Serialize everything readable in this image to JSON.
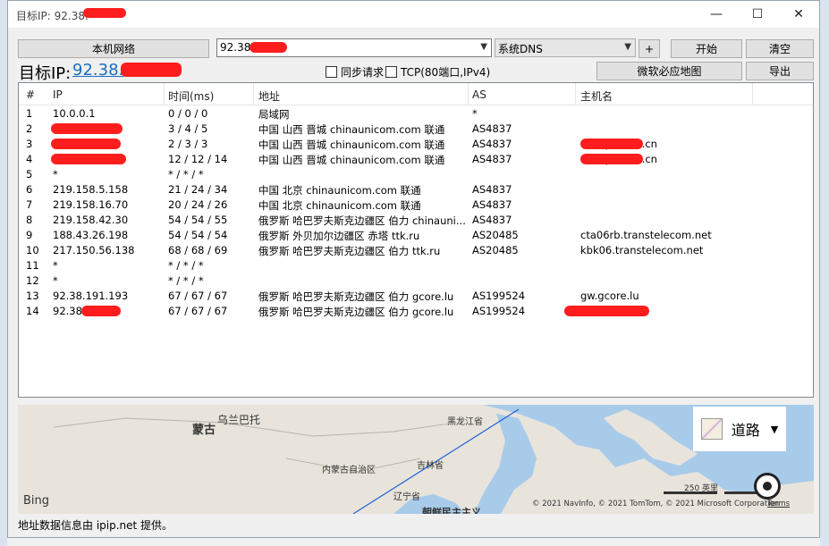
{
  "window": {
    "title": "目标IP: 92.38.",
    "minimize_glyph": "—",
    "maximize_glyph": "☐",
    "close_glyph": "✕"
  },
  "toolbar": {
    "local_network_btn": "本机网络",
    "ip_input_value": "92.38.",
    "dns_select_value": "系统DNS",
    "plus_btn": "+",
    "start_btn": "开始",
    "clear_btn": "清空",
    "map_btn": "微软必应地图",
    "export_btn": "导出"
  },
  "target": {
    "label": "目标IP:",
    "ip": "92.38."
  },
  "options": {
    "sync_label": "同步请求",
    "tcp_label": "TCP(80端口,IPv4)"
  },
  "table": {
    "headers": [
      "#",
      "IP",
      "时间(ms)",
      "地址",
      "AS",
      "主机名"
    ],
    "rows": [
      {
        "n": "1",
        "ip": "10.0.0.1",
        "time": "0 / 0 / 0",
        "addr": "局域网",
        "as": "*",
        "host": ""
      },
      {
        "n": "2",
        "ip": "",
        "time": "3 / 4 / 5",
        "addr": "中国 山西 晋城 chinaunicom.com 联通",
        "as": "AS4837",
        "host": ""
      },
      {
        "n": "3",
        "ip": "",
        "time": "2 / 3 / 3",
        "addr": "中国 山西 晋城 chinaunicom.com 联通",
        "as": "AS4837",
        "host": "adsl-pool.sx.cn"
      },
      {
        "n": "4",
        "ip": "",
        "time": "12 / 12 / 14",
        "addr": "中国 山西 晋城 chinaunicom.com 联通",
        "as": "AS4837",
        "host": "adsl-pool.sx.cn"
      },
      {
        "n": "5",
        "ip": "*",
        "time": "* / * / *",
        "addr": "",
        "as": "",
        "host": ""
      },
      {
        "n": "6",
        "ip": "219.158.5.158",
        "time": "21 / 24 / 34",
        "addr": "中国 北京 chinaunicom.com 联通",
        "as": "AS4837",
        "host": ""
      },
      {
        "n": "7",
        "ip": "219.158.16.70",
        "time": "20 / 24 / 26",
        "addr": "中国 北京 chinaunicom.com 联通",
        "as": "AS4837",
        "host": ""
      },
      {
        "n": "8",
        "ip": "219.158.42.30",
        "time": "54 / 54 / 55",
        "addr": "俄罗斯 哈巴罗夫斯克边疆区 伯力 chinauni...",
        "as": "AS4837",
        "host": ""
      },
      {
        "n": "9",
        "ip": "188.43.26.198",
        "time": "54 / 54 / 54",
        "addr": "俄罗斯 外贝加尔边疆区 赤塔 ttk.ru",
        "as": "AS20485",
        "host": "cta06rb.transtelecom.net"
      },
      {
        "n": "10",
        "ip": "217.150.56.138",
        "time": "68 / 68 / 69",
        "addr": "俄罗斯 哈巴罗夫斯克边疆区 伯力 ttk.ru",
        "as": "AS20485",
        "host": "kbk06.transtelecom.net"
      },
      {
        "n": "11",
        "ip": "*",
        "time": "* / * / *",
        "addr": "",
        "as": "",
        "host": ""
      },
      {
        "n": "12",
        "ip": "*",
        "time": "* / * / *",
        "addr": "",
        "as": "",
        "host": ""
      },
      {
        "n": "13",
        "ip": "92.38.191.193",
        "time": "67 / 67 / 67",
        "addr": "俄罗斯 哈巴罗夫斯克边疆区 伯力 gcore.lu",
        "as": "AS199524",
        "host": "gw.gcore.lu"
      },
      {
        "n": "14",
        "ip": "92.38.",
        "time": "67 / 67 / 67",
        "addr": "俄罗斯 哈巴罗夫斯克边疆区 伯力 gcore.lu",
        "as": "AS199524",
        "host": ""
      }
    ]
  },
  "map": {
    "labels": {
      "mongolia": "蒙古",
      "ulaanbaatar": "乌兰巴托",
      "heilongjiang": "黑龙江省",
      "inner_mongolia": "内蒙古自治区",
      "jilin": "吉林省",
      "liaoning": "辽宁省",
      "north_korea": "朝鲜民主主义"
    },
    "road_label": "道路",
    "bing_label": "Bing",
    "scale_label": "250 英里",
    "copyright": "© 2021 NavInfo, © 2021 TomTom, © 2021 Microsoft Corporation",
    "terms": "Terms"
  },
  "status": {
    "text": "地址数据信息由 ipip.net 提供。"
  },
  "colors": {
    "link": "#1a6fc1",
    "redaction": "#ff1d1d",
    "sea": "#a8cbe9",
    "land": "#e8e4dc"
  }
}
